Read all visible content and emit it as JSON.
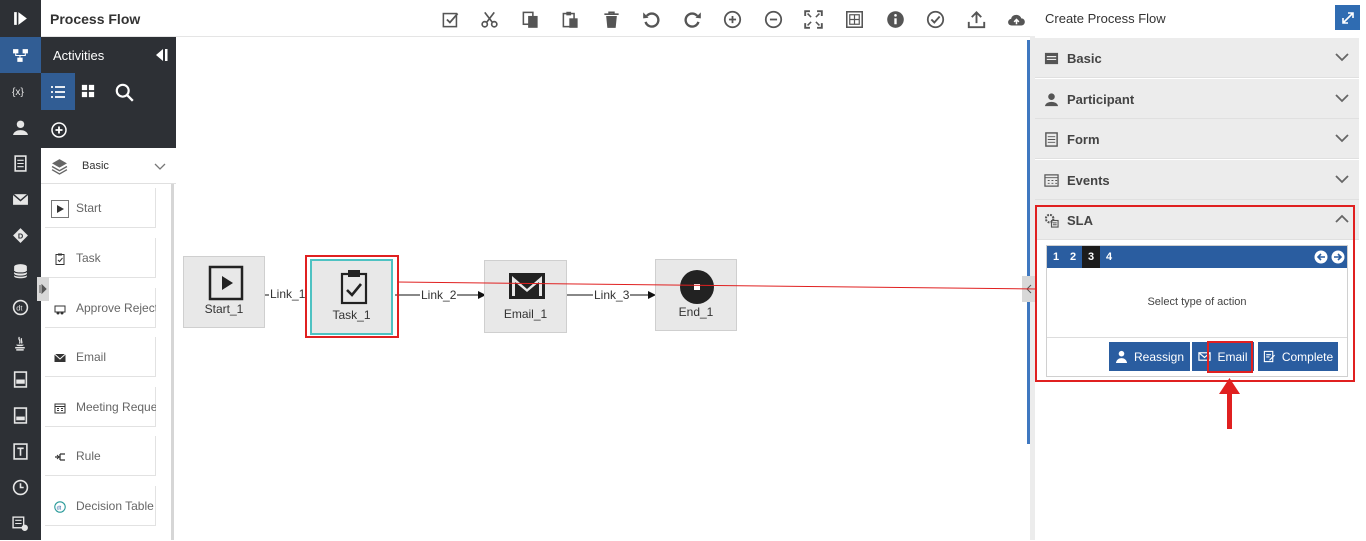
{
  "header": {
    "title": "Process Flow"
  },
  "activities": {
    "title": "Activities",
    "group_select": "Basic",
    "items": [
      {
        "label": "Start",
        "icon": "play-icon"
      },
      {
        "label": "Task",
        "icon": "clipboard-icon"
      },
      {
        "label": "Approve Reject",
        "icon": "approve-icon"
      },
      {
        "label": "Email",
        "icon": "email-icon"
      },
      {
        "label": "Meeting Request",
        "icon": "calendar-icon"
      },
      {
        "label": "Rule",
        "icon": "rule-icon"
      },
      {
        "label": "Decision Table",
        "icon": "decision-table-icon"
      }
    ]
  },
  "flow": {
    "nodes": [
      {
        "label": "Start_1"
      },
      {
        "label": "Task_1"
      },
      {
        "label": "Email_1"
      },
      {
        "label": "End_1"
      }
    ],
    "links": [
      {
        "label": "Link_1"
      },
      {
        "label": "Link_2"
      },
      {
        "label": "Link_3"
      }
    ]
  },
  "right_panel": {
    "title": "Create Process Flow",
    "sections": [
      {
        "label": "Basic",
        "expanded": false
      },
      {
        "label": "Participant",
        "expanded": false
      },
      {
        "label": "Form",
        "expanded": false
      },
      {
        "label": "Events",
        "expanded": false
      },
      {
        "label": "SLA",
        "expanded": true
      }
    ],
    "sla": {
      "steps": [
        "1",
        "2",
        "3",
        "4"
      ],
      "current_step": "3",
      "message": "Select type of action",
      "actions": [
        {
          "label": "Reassign"
        },
        {
          "label": "Email"
        },
        {
          "label": "Complete"
        }
      ]
    }
  },
  "colors": {
    "accent": "#2a5da0",
    "rail": "#2d3035",
    "highlight": "#e02020",
    "selected_node_border": "#4ec2c2"
  }
}
